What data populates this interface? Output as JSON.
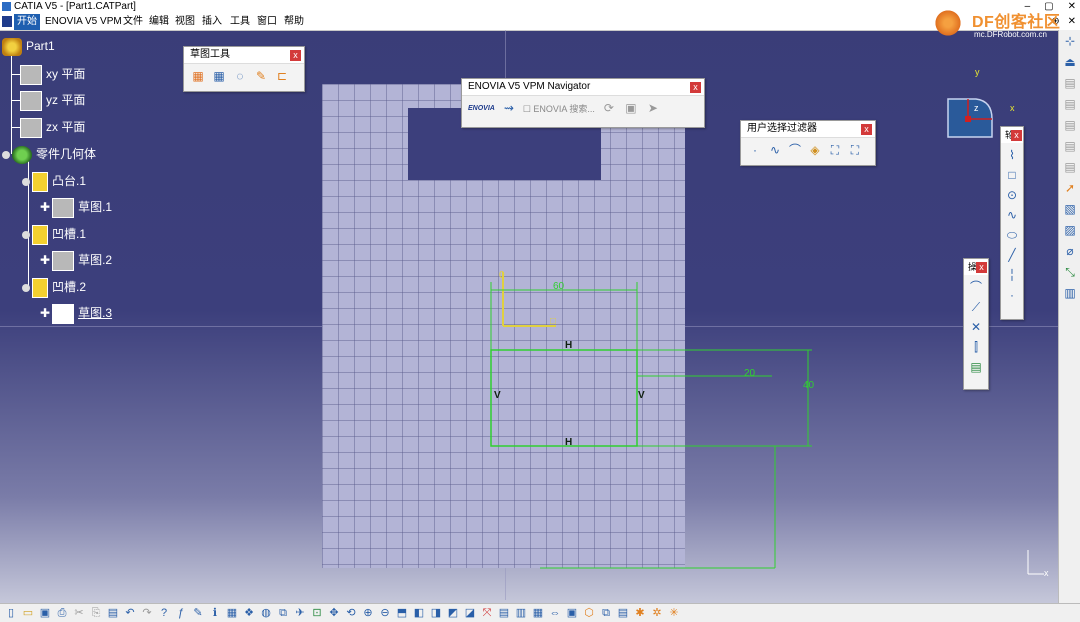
{
  "window": {
    "title": "CATIA V5 - [Part1.CATPart]",
    "controls": [
      "‒",
      "▢",
      "✕"
    ]
  },
  "menu": {
    "items": [
      "开始",
      "ENOVIA V5 VPM",
      "文件",
      "编辑",
      "视图",
      "插入",
      "工具",
      "窗口",
      "帮助"
    ],
    "active": "开始",
    "window_controls": [
      "⊕",
      "✕"
    ]
  },
  "watermark": {
    "brand": "DF创客社区",
    "url": "mc.DFRobot.com.cn"
  },
  "tree": {
    "root": "Part1",
    "planes": [
      "xy 平面",
      "yz 平面",
      "zx 平面"
    ],
    "body": "零件几何体",
    "features": [
      {
        "name": "凸台.1",
        "sketch": "草图.1"
      },
      {
        "name": "凹槽.1",
        "sketch": "草图.2"
      },
      {
        "name": "凹槽.2",
        "sketch": "草图.3",
        "highlight": true
      }
    ]
  },
  "toolbars": {
    "sketch_tools": {
      "title": "草图工具",
      "icons": [
        "grid-icon",
        "snap-icon",
        "construction-icon",
        "constraint-icon",
        "dimension-icon"
      ]
    },
    "enovia": {
      "title": "ENOVIA V5 VPM Navigator",
      "search_label": "ENOVIA 搜索...",
      "logo": "ENOVIA"
    },
    "user_filter": {
      "title": "用户选择过滤器",
      "icons": [
        "point-filter-icon",
        "curve-filter-icon",
        "surface-filter-icon",
        "volume-filter-icon",
        "feature-filter-icon",
        "tool-filter-icon"
      ]
    },
    "profile_label": "轮",
    "ops_label": "操"
  },
  "sketch": {
    "dim_width": "60",
    "dim_offset": "20",
    "dim_height": "40",
    "h_label": "H",
    "v_label": "V",
    "accent": "#30d030",
    "origin_color": "#e0d040"
  },
  "compass": {
    "x": "x",
    "y": "y",
    "z": "z"
  },
  "mini_axis": {
    "x": "x"
  },
  "colors": {
    "background": "#3c3f7c",
    "sheet": "#b3b4d6",
    "menu_active": "#1f5fb0"
  }
}
